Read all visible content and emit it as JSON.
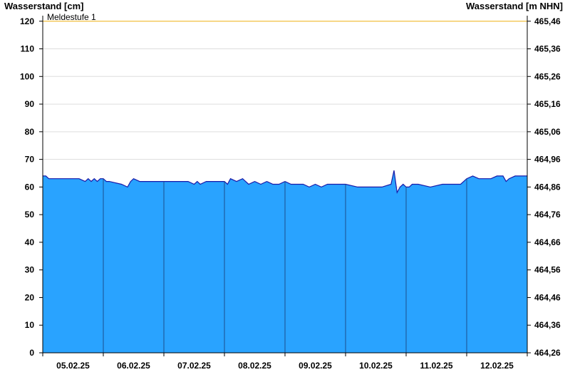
{
  "chart_data": {
    "type": "area",
    "y_left_label": "Wasserstand [cm]",
    "y_right_label": "Wasserstand [m NHN]",
    "ylim": [
      0,
      122
    ],
    "xlim": [
      0,
      8.0
    ],
    "y_left_ticks": [
      0,
      10,
      20,
      30,
      40,
      50,
      60,
      70,
      80,
      90,
      100,
      110,
      120
    ],
    "y_right_ticks": [
      "464,26",
      "464,36",
      "464,46",
      "464,56",
      "464,66",
      "464,76",
      "464,86",
      "464,96",
      "465,06",
      "465,16",
      "465,26",
      "465,36",
      "465,46"
    ],
    "x_tick_labels": [
      "05.02.25",
      "06.02.25",
      "07.02.25",
      "08.02.25",
      "09.02.25",
      "10.02.25",
      "11.02.25",
      "12.02.25"
    ],
    "threshold": {
      "label": "Meldestufe 1",
      "value": 120,
      "color": "#f5c242"
    },
    "colors": {
      "fill": "#29a3ff",
      "line": "#1a1aa8",
      "day_line": "#1a4f8c",
      "grid": "#dddddd"
    },
    "x": [
      0,
      0.05,
      0.1,
      0.6,
      0.7,
      0.75,
      0.8,
      0.85,
      0.9,
      0.95,
      1.0,
      1.05,
      1.1,
      1.3,
      1.4,
      1.45,
      1.5,
      1.6,
      1.7,
      2.0,
      2.2,
      2.4,
      2.5,
      2.55,
      2.6,
      2.7,
      2.8,
      2.9,
      3.0,
      3.05,
      3.1,
      3.2,
      3.3,
      3.4,
      3.5,
      3.6,
      3.7,
      3.8,
      3.9,
      4.0,
      4.1,
      4.2,
      4.3,
      4.4,
      4.5,
      4.6,
      4.7,
      4.8,
      5.0,
      5.2,
      5.4,
      5.6,
      5.75,
      5.8,
      5.85,
      5.9,
      5.95,
      6.0,
      6.05,
      6.1,
      6.2,
      6.4,
      6.6,
      6.8,
      6.9,
      7.0,
      7.1,
      7.2,
      7.4,
      7.5,
      7.6,
      7.65,
      7.7,
      7.8,
      8.0
    ],
    "values": [
      64,
      64,
      63,
      63,
      62,
      63,
      62,
      63,
      62,
      63,
      63,
      62,
      62,
      61,
      60,
      62,
      63,
      62,
      62,
      62,
      62,
      62,
      61,
      62,
      61,
      62,
      62,
      62,
      62,
      61,
      63,
      62,
      63,
      61,
      62,
      61,
      62,
      61,
      61,
      62,
      61,
      61,
      61,
      60,
      61,
      60,
      61,
      61,
      61,
      60,
      60,
      60,
      61,
      66,
      58,
      60,
      61,
      60,
      60,
      61,
      61,
      60,
      61,
      61,
      61,
      63,
      64,
      63,
      63,
      64,
      64,
      62,
      63,
      64,
      64
    ]
  }
}
